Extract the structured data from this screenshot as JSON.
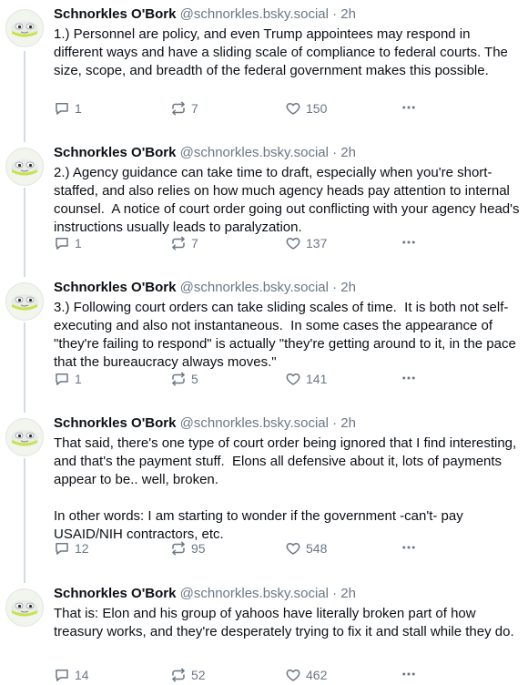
{
  "posts": [
    {
      "author": "Schnorkles O'Bork",
      "handle": "@schnorkles.bsky.social",
      "time": "· 2h",
      "text": "1.) Personnel are policy, and even Trump appointees may respond in different ways and have a sliding scale of compliance to federal courts. The size, scope, and breadth of the federal government makes this possible.",
      "replies": "1",
      "reposts": "7",
      "likes": "150"
    },
    {
      "author": "Schnorkles O'Bork",
      "handle": "@schnorkles.bsky.social",
      "time": "· 2h",
      "text": "2.) Agency guidance can take time to draft, especially when you're short-staffed, and also relies on how much agency heads pay attention to internal counsel.  A notice of court order going out conflicting with your agency head's instructions usually leads to paralyzation.",
      "replies": "1",
      "reposts": "7",
      "likes": "137"
    },
    {
      "author": "Schnorkles O'Bork",
      "handle": "@schnorkles.bsky.social",
      "time": "· 2h",
      "text": "3.) Following court orders can take sliding scales of time.  It is both not self-executing and also not instantaneous.  In some cases the appearance of \"they're failing to respond\" is actually \"they're getting around to it, in the pace that the bureaucracy always moves.\"",
      "replies": "1",
      "reposts": "5",
      "likes": "141"
    },
    {
      "author": "Schnorkles O'Bork",
      "handle": "@schnorkles.bsky.social",
      "time": "· 2h",
      "text": "That said, there's one type of court order being ignored that I find interesting, and that's the payment stuff.  Elons all defensive about it, lots of payments appear to be.. well, broken.\n\nIn other words: I am starting to wonder if the government -can't- pay USAID/NIH contractors, etc.",
      "replies": "12",
      "reposts": "95",
      "likes": "548"
    },
    {
      "author": "Schnorkles O'Bork",
      "handle": "@schnorkles.bsky.social",
      "time": "· 2h",
      "text": "That is: Elon and his group of yahoos have literally broken part of how treasury works, and they're desperately trying to fix it and stall while they do.",
      "replies": "14",
      "reposts": "52",
      "likes": "462"
    }
  ],
  "icons": {
    "reply": "speech-bubble-icon",
    "repost": "repost-arrows-icon",
    "like": "heart-icon",
    "more": "ellipsis-icon"
  },
  "colors": {
    "text": "#0b0f14",
    "muted": "#6b7785",
    "thread_line": "#d4dbe2",
    "avatar_bg": "#f2f4ee",
    "avatar_accent": "#c8e34a"
  }
}
